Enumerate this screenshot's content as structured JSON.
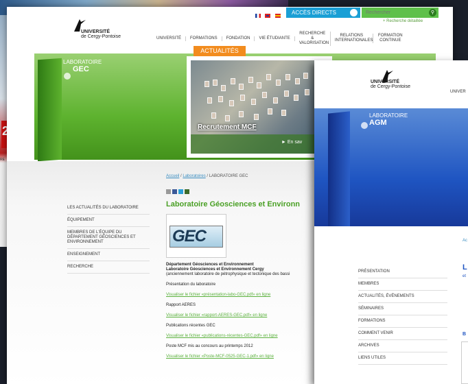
{
  "colors": {
    "accent_blue": "#1a9fd5",
    "search_green": "#5ec04a",
    "gec_green": "#5db22e",
    "actualites_orange": "#f28c1e",
    "agm_blue": "#1f55c2",
    "link_green": "#5bb13d"
  },
  "left_badge": "2",
  "left_note": "RE",
  "gec_window": {
    "logo": {
      "line1": "UNIVERSITÉ",
      "line2": "de Cergy-Pontoise"
    },
    "topbar": {
      "acces_label": "ACCÈS DIRECTS",
      "search_placeholder": "Rechercher",
      "search_detail": "+ Recherche détaillée"
    },
    "nav": [
      "UNIVERSITÉ",
      "FORMATIONS",
      "FONDATION",
      "VIE ÉTUDIANTE",
      "RECHERCHE & VALORISATION",
      "RELATIONS INTERNATIONALES",
      "FORMATION CONTINUE"
    ],
    "laboratoire": {
      "small": "LABORATOIRE",
      "big": "GEC"
    },
    "actualites_tab": "ACTUALITÉS",
    "feature": {
      "title": "Recrutement MCF",
      "more": "► En sav"
    },
    "breadcrumb": {
      "home": "Accueil",
      "labs": "Laboratoires",
      "current": " / LABORATOIRE GEC"
    },
    "title": "Laboratoire Géosciences et Environn",
    "logo_text": "GEC",
    "sidenav": [
      "LES ACTUALITÉS DU LABORATOIRE",
      "ÉQUIPEMENT",
      "MEMBRES DE L'ÉQUIPE DU DÉPARTEMENT GÉOSCIENCES ET ENVIRONNEMENT",
      "ENSEIGNEMENT",
      "RECHERCHE"
    ],
    "body": {
      "dept": "Département Géosciences et Environnement",
      "lab": "Laboratoire Géosciences et Environnement Cergy",
      "former": "(anciennement laboratoire de pétrophysique et tectonique des bassi",
      "pres_label": "Présentation du laboratoire",
      "pres_link": "Visualiser le fichier «présentation-labo-GEC.pdf» en ligne",
      "aeres_label": "Rapport AERES",
      "aeres_link": "Visualiser le fichier «rapport-AERES-GEC.pdf» en ligne",
      "pub_label": "Publications récentes GEC",
      "pub_link": "Visualiser le fichier «publications-récentes-GEC.pdf» en ligne",
      "poste_label": "Poste MCF mis au concours au printemps 2012",
      "poste_link": "Visualiser le fichier «Poste-MCF-0525-GEC-1.pdf» en ligne"
    }
  },
  "agm_window": {
    "logo": {
      "line1": "UNIVERSITÉ",
      "line2": "de Cergy-Pontoise"
    },
    "nav_first": "UNIVER",
    "laboratoire": {
      "small": "LABORATOIRE",
      "big": "AGM"
    },
    "sidenav": [
      "PRÉSENTATION",
      "MEMBRES",
      "ACTUALITÉS, ÉVÉNEMENTS",
      "SÉMINAIRES",
      "FORMATIONS",
      "COMMENT VENIR",
      "ARCHIVES",
      "LIENS UTILES"
    ],
    "right_bits": {
      "crumb": "Ac",
      "title": "L",
      "sub": "et",
      "b": "B"
    }
  }
}
